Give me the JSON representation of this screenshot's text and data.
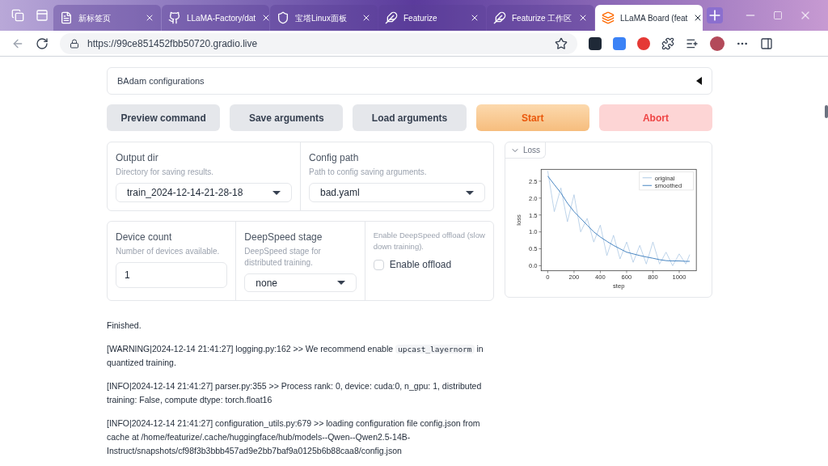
{
  "browser": {
    "tabs": [
      {
        "label": "新标签页",
        "selected": false,
        "kind": "page"
      },
      {
        "label": "LLaMA-Factory/dat",
        "selected": false,
        "kind": "github"
      },
      {
        "label": "宝塔Linux面板",
        "selected": false,
        "kind": "shield"
      },
      {
        "label": "Featurize",
        "selected": false,
        "kind": "feather"
      },
      {
        "label": "Featurize 工作区",
        "selected": false,
        "kind": "feather"
      },
      {
        "label": "LLaMA Board (feat",
        "selected": true,
        "kind": "layers"
      }
    ],
    "address": "https://99ce851452fbb50720.gradio.live"
  },
  "accordion": {
    "label": "BAdam configurations",
    "expanded": false
  },
  "buttons": [
    {
      "label": "Preview command",
      "kind": "secondary"
    },
    {
      "label": "Save arguments",
      "kind": "secondary"
    },
    {
      "label": "Load arguments",
      "kind": "secondary"
    },
    {
      "label": "Start",
      "kind": "primary"
    },
    {
      "label": "Abort",
      "kind": "stop"
    }
  ],
  "output_dir": {
    "label": "Output dir",
    "info": "Directory for saving results.",
    "value": "train_2024-12-14-21-28-18"
  },
  "config_path": {
    "label": "Config path",
    "info": "Path to config saving arguments.",
    "value": "bad.yaml"
  },
  "device_count": {
    "label": "Device count",
    "info": "Number of devices available.",
    "value": "1"
  },
  "deepspeed_stage": {
    "label": "DeepSpeed stage",
    "info": "DeepSpeed stage for distributed training.",
    "value": "none"
  },
  "offload": {
    "info": "Enable DeepSpeed offload (slow down training).",
    "label": "Enable offload",
    "checked": false
  },
  "loss_panel": {
    "label": "Loss",
    "chart_data": {
      "type": "line",
      "legend": true,
      "xlabel": "step",
      "ylabel": "loss",
      "xlim": [
        -50,
        1130
      ],
      "ylim": [
        -0.15,
        2.85
      ],
      "xticks": [
        0,
        200,
        400,
        600,
        800,
        1000
      ],
      "yticks": [
        {
          "value": 0,
          "label": "0.0"
        },
        {
          "value": 0.5,
          "label": "0.5"
        },
        {
          "value": 1,
          "label": "1.0"
        },
        {
          "value": 1.5,
          "label": "1.5"
        },
        {
          "value": 2,
          "label": "2.0"
        },
        {
          "value": 2.5,
          "label": "2.5"
        }
      ],
      "x": [
        0,
        50,
        100,
        150,
        200,
        250,
        300,
        350,
        400,
        450,
        500,
        550,
        600,
        650,
        700,
        750,
        800,
        850,
        900,
        950,
        1000,
        1050,
        1080
      ],
      "series": [
        {
          "name": "original",
          "color": "#a9c6e3",
          "values": [
            2.8,
            1.6,
            2.3,
            1.3,
            2.1,
            1.0,
            1.4,
            0.7,
            1.2,
            0.3,
            0.9,
            0.2,
            0.7,
            0.1,
            0.6,
            0.05,
            0.7,
            0.05,
            0.4,
            0.0,
            0.35,
            0.05,
            0.33
          ]
        },
        {
          "name": "smoothed",
          "color": "#3f7fbf",
          "values": [
            2.65,
            2.4,
            2.15,
            1.85,
            1.6,
            1.4,
            1.2,
            1.0,
            0.85,
            0.72,
            0.6,
            0.5,
            0.4,
            0.35,
            0.3,
            0.26,
            0.22,
            0.18,
            0.15,
            0.14,
            0.14,
            0.13,
            0.13
          ]
        }
      ]
    }
  },
  "log": [
    [
      {
        "kind": "text",
        "text": "Finished."
      }
    ],
    [
      {
        "kind": "text",
        "text": "[WARNING|2024-12-14 21:41:27] logging.py:162 >> We recommend enable "
      },
      {
        "kind": "code",
        "text": "upcast_layernorm"
      },
      {
        "kind": "text",
        "text": " in quantized training."
      }
    ],
    [
      {
        "kind": "text",
        "text": "[INFO|2024-12-14 21:41:27] parser.py:355 >> Process rank: 0, device: cuda:0, n_gpu: 1, distributed training: False, compute dtype: torch.float16"
      }
    ],
    [
      {
        "kind": "text",
        "text": "[INFO|2024-12-14 21:41:27] configuration_utils.py:679 >> loading configuration file config.json from cache at /home/featurize/.cache/huggingface/hub/models--Qwen--Qwen2.5-14B-Instruct/snapshots/cf98f3b3bbb457ad9e2bb7baf9a0125b6b88caa8/config.json"
      }
    ]
  ]
}
